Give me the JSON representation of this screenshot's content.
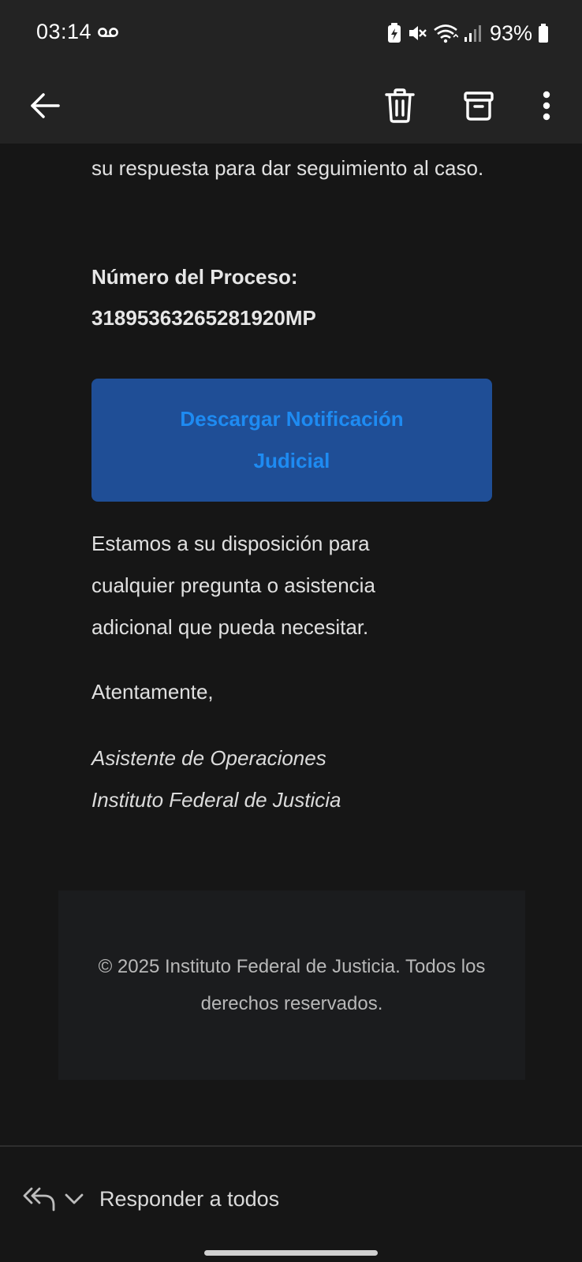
{
  "status_bar": {
    "time": "03:14",
    "battery": "93%",
    "icons": [
      "voicemail-icon",
      "battery-saver-icon",
      "mute-icon",
      "wifi-icon",
      "signal-icon",
      "battery-icon"
    ]
  },
  "app_bar": {
    "icons": [
      "back-arrow-icon",
      "trash-icon",
      "archive-icon",
      "more-vert-icon"
    ]
  },
  "email_body": {
    "intro_line": "su respuesta para dar seguimiento al caso.",
    "process_label": "Número del Proceso:",
    "process_number": "31895363265281920MP",
    "download_button": "Descargar Notificación Judicial",
    "availability": "Estamos a su disposición para cualquier pregunta o asistencia adicional que pueda necesitar.",
    "closing": "Atentamente,",
    "signature_title": "Asistente de Operaciones",
    "signature_org": "Instituto Federal de Justicia",
    "footer": "© 2025 Instituto Federal de Justicia. Todos los derechos reservados."
  },
  "bottom_bar": {
    "reply_label": "Responder a todos",
    "icons": [
      "reply-all-icon",
      "chevron-down-icon"
    ]
  },
  "colors": {
    "background": "#161616",
    "app_bar": "#232323",
    "button_bg": "#1f4e96",
    "button_text": "#1e8bf2",
    "footer_bg": "#1b1c1e"
  }
}
